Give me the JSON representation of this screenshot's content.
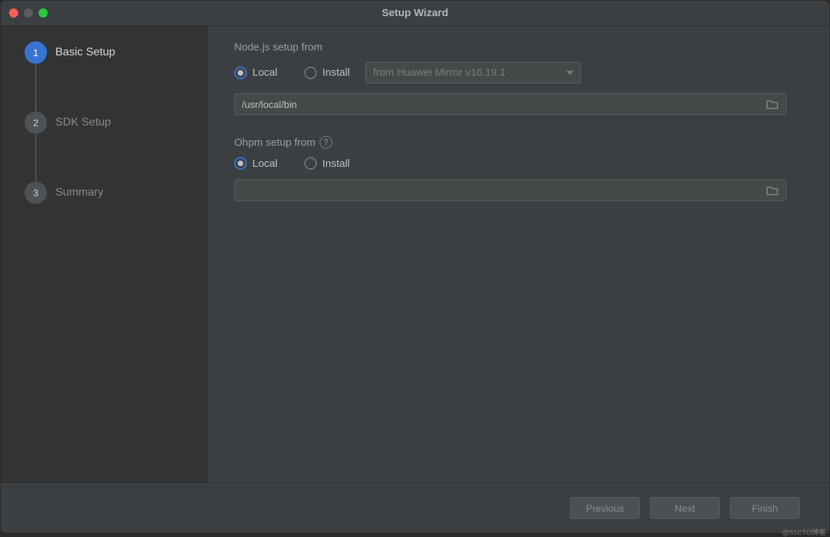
{
  "window": {
    "title": "Setup Wizard"
  },
  "sidebar": {
    "steps": [
      {
        "num": "1",
        "label": "Basic Setup",
        "active": true
      },
      {
        "num": "2",
        "label": "SDK Setup",
        "active": false
      },
      {
        "num": "3",
        "label": "Summary",
        "active": false
      }
    ]
  },
  "main": {
    "nodejs": {
      "heading": "Node.js setup from",
      "options": {
        "local": "Local",
        "install": "Install"
      },
      "selected": "local",
      "mirror_dropdown": "from Huawei Mirror v16.19.1",
      "path": "/usr/local/bin"
    },
    "ohpm": {
      "heading": "Ohpm setup from",
      "options": {
        "local": "Local",
        "install": "Install"
      },
      "selected": "local",
      "path": ""
    }
  },
  "footer": {
    "previous": "Previous",
    "next": "Next",
    "finish": "Finish"
  },
  "watermark": "@51CTO博客"
}
